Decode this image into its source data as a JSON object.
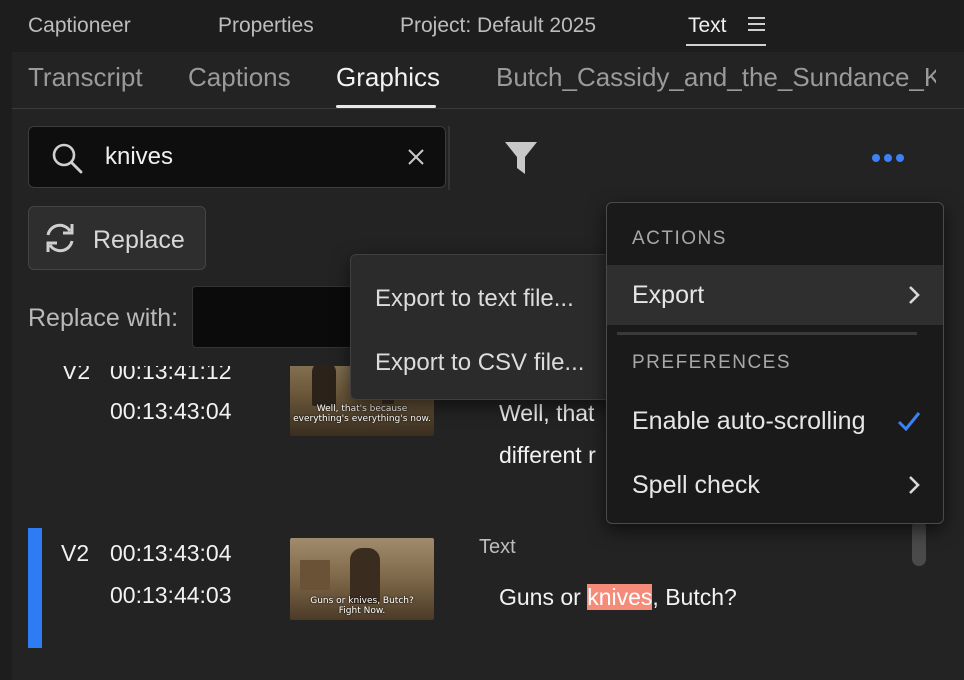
{
  "workspace_tabs": [
    "Captioneer",
    "Properties",
    "Project: Default 2025",
    "Text"
  ],
  "panel_tabs": [
    "Transcript",
    "Captions",
    "Graphics",
    "Butch_Cassidy_and_the_Sundance_Kid"
  ],
  "search": {
    "value": "knives"
  },
  "replace": {
    "button_label": "Replace",
    "with_label": "Replace with:"
  },
  "rows": [
    {
      "track": "V2",
      "start": "00:13:41:12",
      "end": "00:13:43:04",
      "thumb_caption": [
        "Well, that's because",
        "everything's everything's now."
      ],
      "lines": [
        "Well, that",
        "different r"
      ]
    },
    {
      "track": "V2",
      "start": "00:13:43:04",
      "end": "00:13:44:03",
      "type_label": "Text",
      "thumb_caption": [
        "Guns or knives, Butch?",
        "Fight Now."
      ],
      "text_before": "Guns or ",
      "text_match": "knives",
      "text_after": ", Butch?"
    }
  ],
  "export_submenu": [
    "Export to text file...",
    "Export to CSV file..."
  ],
  "actions_menu": {
    "actions_heading": "ACTIONS",
    "export": "Export",
    "preferences_heading": "PREFERENCES",
    "auto_scroll": "Enable auto-scrolling",
    "auto_scroll_checked": true,
    "spell_check": "Spell check"
  },
  "colors": {
    "accent": "#2d7cf4",
    "highlight": "#f58c7a",
    "check": "#3b82f6"
  }
}
